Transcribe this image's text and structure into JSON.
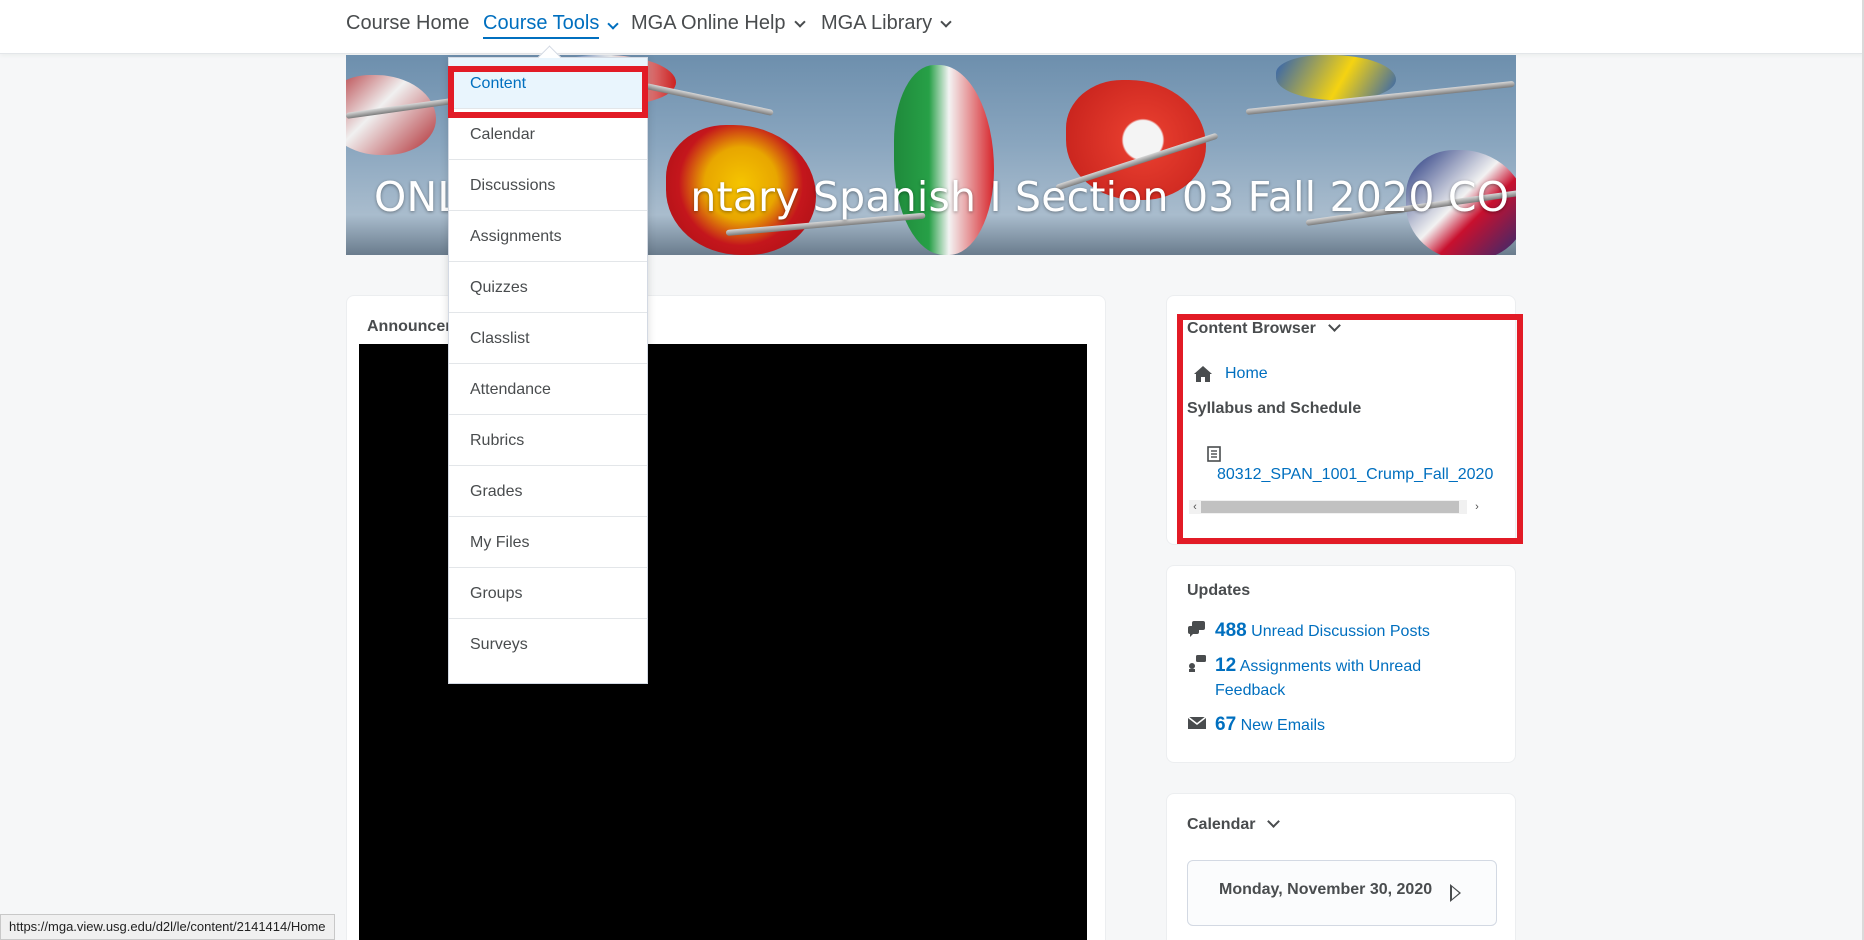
{
  "nav": {
    "items": [
      {
        "label": "Course Home",
        "active": false,
        "has_menu": false
      },
      {
        "label": "Course Tools",
        "active": true,
        "has_menu": true
      },
      {
        "label": "MGA Online Help",
        "active": false,
        "has_menu": true
      },
      {
        "label": "MGA Library",
        "active": false,
        "has_menu": true
      }
    ]
  },
  "banner": {
    "title": "ONLINE Elementary Spanish I Section 03 Fall 2020 CO",
    "visible_title_left": "ONL",
    "visible_title_right": "ntary Spanish I Section 03 Fall 2020 CO"
  },
  "dropdown": {
    "items": [
      "Content",
      "Calendar",
      "Discussions",
      "Assignments",
      "Quizzes",
      "Classlist",
      "Attendance",
      "Rubrics",
      "Grades",
      "My Files",
      "Groups",
      "Surveys"
    ],
    "selected": "Content"
  },
  "announcements": {
    "title_visible": "Announcem"
  },
  "content_browser": {
    "title": "Content Browser",
    "home_label": "Home",
    "section": "Syllabus and Schedule",
    "file_name": "80312_SPAN_1001_Crump_Fall_2020"
  },
  "updates": {
    "title": "Updates",
    "rows": [
      {
        "count": "488",
        "label": "Unread Discussion Posts",
        "icon": "discussion-icon"
      },
      {
        "count": "12",
        "label": "Assignments with Unread",
        "label2": "Feedback",
        "icon": "assignment-feedback-icon"
      },
      {
        "count": "67",
        "label": "New Emails",
        "icon": "email-icon"
      }
    ]
  },
  "calendar": {
    "title": "Calendar",
    "date": "Monday, November 30, 2020"
  },
  "status_url": "https://mga.view.usg.edu/d2l/le/content/2141414/Home",
  "colors": {
    "link": "#006fbf",
    "highlight": "#e21b26",
    "text": "#494c4e"
  }
}
